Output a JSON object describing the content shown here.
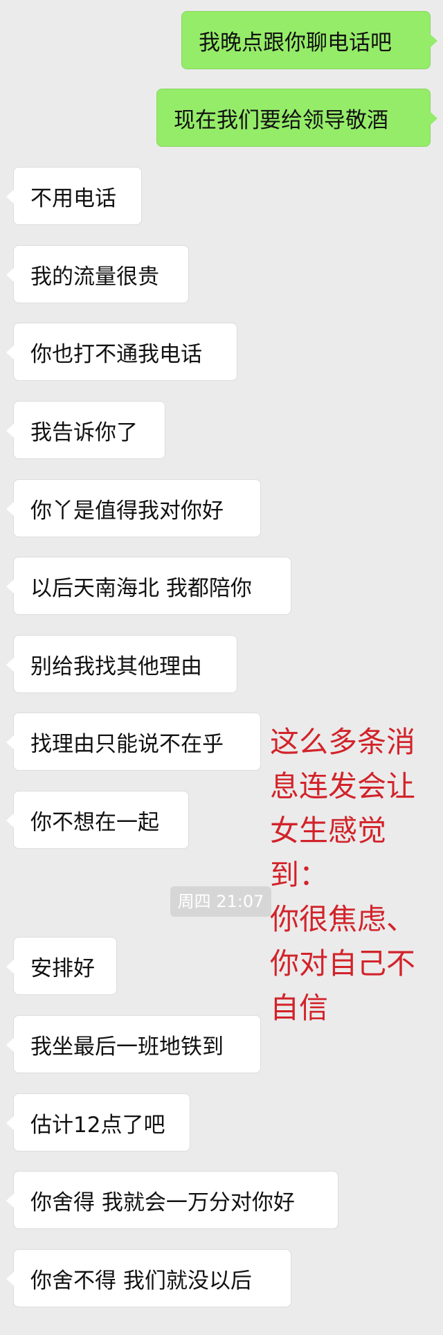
{
  "messages": [
    {
      "text": "我晚点跟你聊电话吧",
      "side": "out"
    },
    {
      "text": "现在我们要给领导敬酒",
      "side": "out"
    },
    {
      "text": "不用电话",
      "side": "in"
    },
    {
      "text": "我的流量很贵",
      "side": "in"
    },
    {
      "text": "你也打不通我电话",
      "side": "in"
    },
    {
      "text": "我告诉你了",
      "side": "in"
    },
    {
      "text": "你丫是值得我对你好",
      "side": "in"
    },
    {
      "text": "以后天南海北 我都陪你",
      "side": "in"
    },
    {
      "text": "别给我找其他理由",
      "side": "in"
    },
    {
      "text": "找理由只能说不在乎",
      "side": "in"
    },
    {
      "text": "你不想在一起",
      "side": "in"
    },
    {
      "text": "安排好",
      "side": "in"
    },
    {
      "text": "我坐最后一班地铁到",
      "side": "in"
    },
    {
      "text": "估计12点了吧",
      "side": "in"
    },
    {
      "text": "你舍得 我就会一万分对你好",
      "side": "in"
    },
    {
      "text": "你舍不得 我们就没以后",
      "side": "in"
    }
  ],
  "timestamp": "周四 21:07",
  "annotation": {
    "lines": [
      "这么多条消",
      "息连发会让",
      "女生感觉",
      "到：",
      "你很焦虑、",
      "你对自己不",
      "自信"
    ],
    "color": "#d2232a"
  },
  "colors": {
    "background": "#ebebeb",
    "incoming_bubble": "#ffffff",
    "outgoing_bubble": "#95ec69"
  }
}
